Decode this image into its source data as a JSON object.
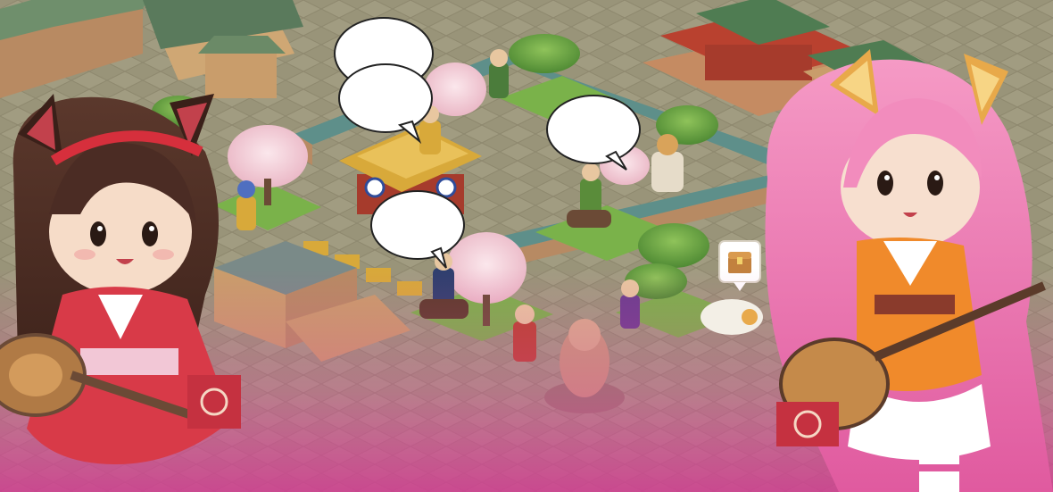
{
  "scene": {
    "type": "isometric city-building game promotional art",
    "colors": {
      "ground": "#8d8a6e",
      "path": "#b6ae94",
      "wall_top": "#5e8f8a",
      "wall_side": "#b78a63",
      "grass": "#7ab24a",
      "blossom": "#f2cfd8",
      "roof_red": "#b9412f",
      "roof_green": "#4f7c52",
      "roof_gold": "#d8a93a",
      "pink_haze": "#e3479f",
      "girl_left_dress": "#d83a48",
      "girl_left_hair": "#4b2c24",
      "girl_right_hair": "#f07cb4",
      "girl_right_dress": "#f08a2b"
    }
  },
  "speech_bubbles": [
    {
      "name": "bubble-top-left",
      "text": ""
    },
    {
      "name": "bubble-top-left-2",
      "text": ""
    },
    {
      "name": "bubble-center-right",
      "text": ""
    },
    {
      "name": "bubble-lower-center",
      "text": ""
    }
  ],
  "map_marker": {
    "icon": "treasure-chest-icon"
  },
  "characters": {
    "left": {
      "icon": "fox-girl-lute-player-left"
    },
    "right": {
      "icon": "fox-girl-pipa-player-right"
    }
  }
}
